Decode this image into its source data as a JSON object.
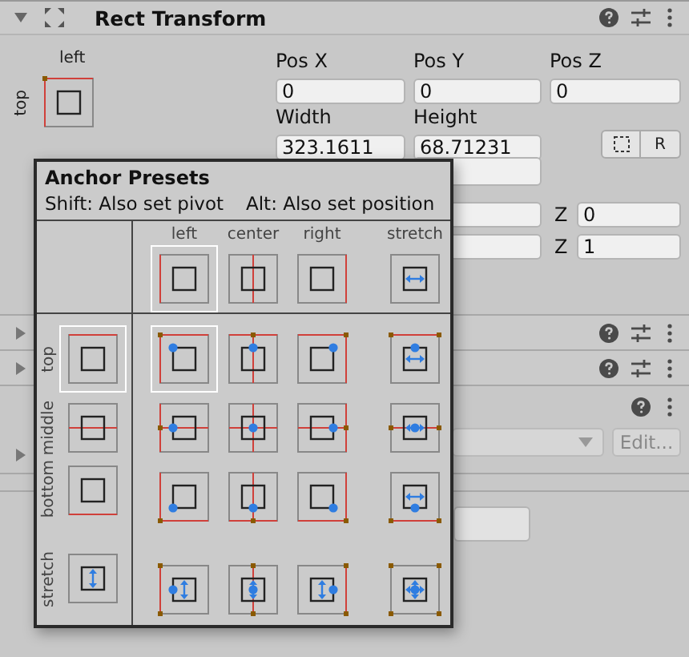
{
  "component": {
    "title": "Rect Transform",
    "expanded": true
  },
  "anchor": {
    "column": "left",
    "row": "top"
  },
  "position_fields": [
    {
      "label": "Pos X",
      "value": "0"
    },
    {
      "label": "Pos Y",
      "value": "0"
    },
    {
      "label": "Pos Z",
      "value": "0"
    }
  ],
  "size_fields": [
    {
      "label": "Width",
      "value": "323.1611"
    },
    {
      "label": "Height",
      "value": "68.71231"
    }
  ],
  "edit_buttons": [
    {
      "kind": "blueprint"
    },
    {
      "kind": "raw",
      "label": "R"
    }
  ],
  "z_fields": [
    {
      "label": "Z",
      "value": "0"
    },
    {
      "label": "Z",
      "value": "1"
    }
  ],
  "collapsed_components": [
    {
      "expanded": false
    },
    {
      "expanded": false
    }
  ],
  "lower_section": {
    "foldout_expanded": false,
    "button": "Edit..."
  },
  "anchor_presets": {
    "title": "Anchor Presets",
    "hints": [
      "Shift: Also set pivot",
      "Alt: Also set position"
    ],
    "columns": [
      {
        "label": "left",
        "selected": true
      },
      {
        "label": "center",
        "selected": false
      },
      {
        "label": "right",
        "selected": false
      },
      {
        "label": "stretch",
        "selected": false
      }
    ],
    "rows": [
      {
        "label": "top",
        "selected": true
      },
      {
        "label": "middle",
        "selected": false
      },
      {
        "label": "bottom",
        "selected": false
      },
      {
        "label": "stretch",
        "selected": false
      }
    ]
  }
}
